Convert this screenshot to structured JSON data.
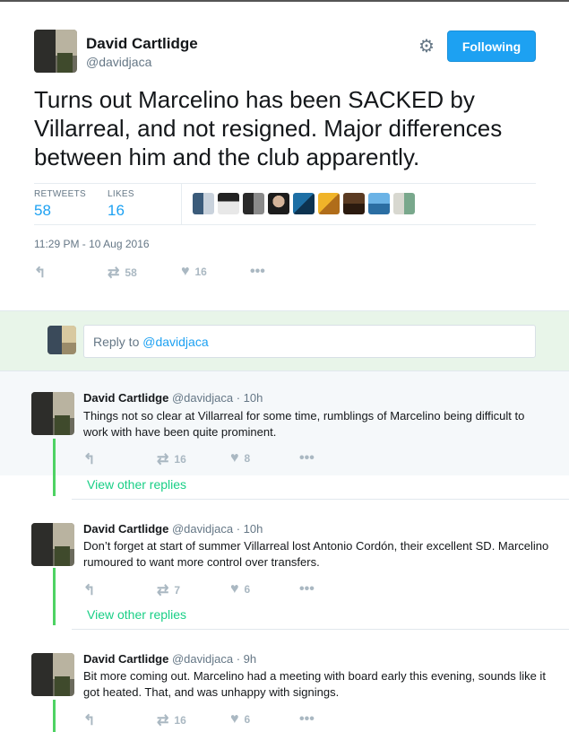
{
  "tweet": {
    "author_name": "David Cartlidge",
    "author_handle": "@davidjaca",
    "follow_label": "Following",
    "text": "Turns out Marcelino has been SACKED by Villarreal, and not resigned. Major differences between him and the club apparently.",
    "retweets_label": "RETWEETS",
    "retweets_count": "58",
    "likes_label": "LIKES",
    "likes_count": "16",
    "timestamp": "11:29 PM - 10 Aug 2016",
    "action_retweet_count": "58",
    "action_like_count": "16"
  },
  "reply_box": {
    "prefix": "Reply to ",
    "mention": "@davidjaca"
  },
  "replies": [
    {
      "name": "David Cartlidge",
      "handle": "@davidjaca",
      "time": "· 10h",
      "text": "Things not so clear at Villarreal for some time, rumblings of Marcelino being difficult to work with have been quite prominent.",
      "retweets": "16",
      "likes": "8",
      "view_other": "View other replies"
    },
    {
      "name": "David Cartlidge",
      "handle": "@davidjaca",
      "time": "· 10h",
      "text": "Don’t forget at start of summer Villarreal lost Antonio Cordón, their excellent SD. Marcelino rumoured to want more control over transfers.",
      "retweets": "7",
      "likes": "6",
      "view_other": "View other replies"
    },
    {
      "name": "David Cartlidge",
      "handle": "@davidjaca",
      "time": "· 9h",
      "text": "Bit more coming out. Marcelino had a meeting with board early this evening, sounds like it got heated. That, and was unhappy with signings.",
      "retweets": "16",
      "likes": "6"
    }
  ],
  "colors": {
    "accent": "#1da1f2",
    "thread": "#4ed263",
    "view_other": "#19cf86"
  },
  "icons": [
    "gear-icon",
    "reply-icon",
    "retweet-icon",
    "heart-icon",
    "more-icon"
  ]
}
